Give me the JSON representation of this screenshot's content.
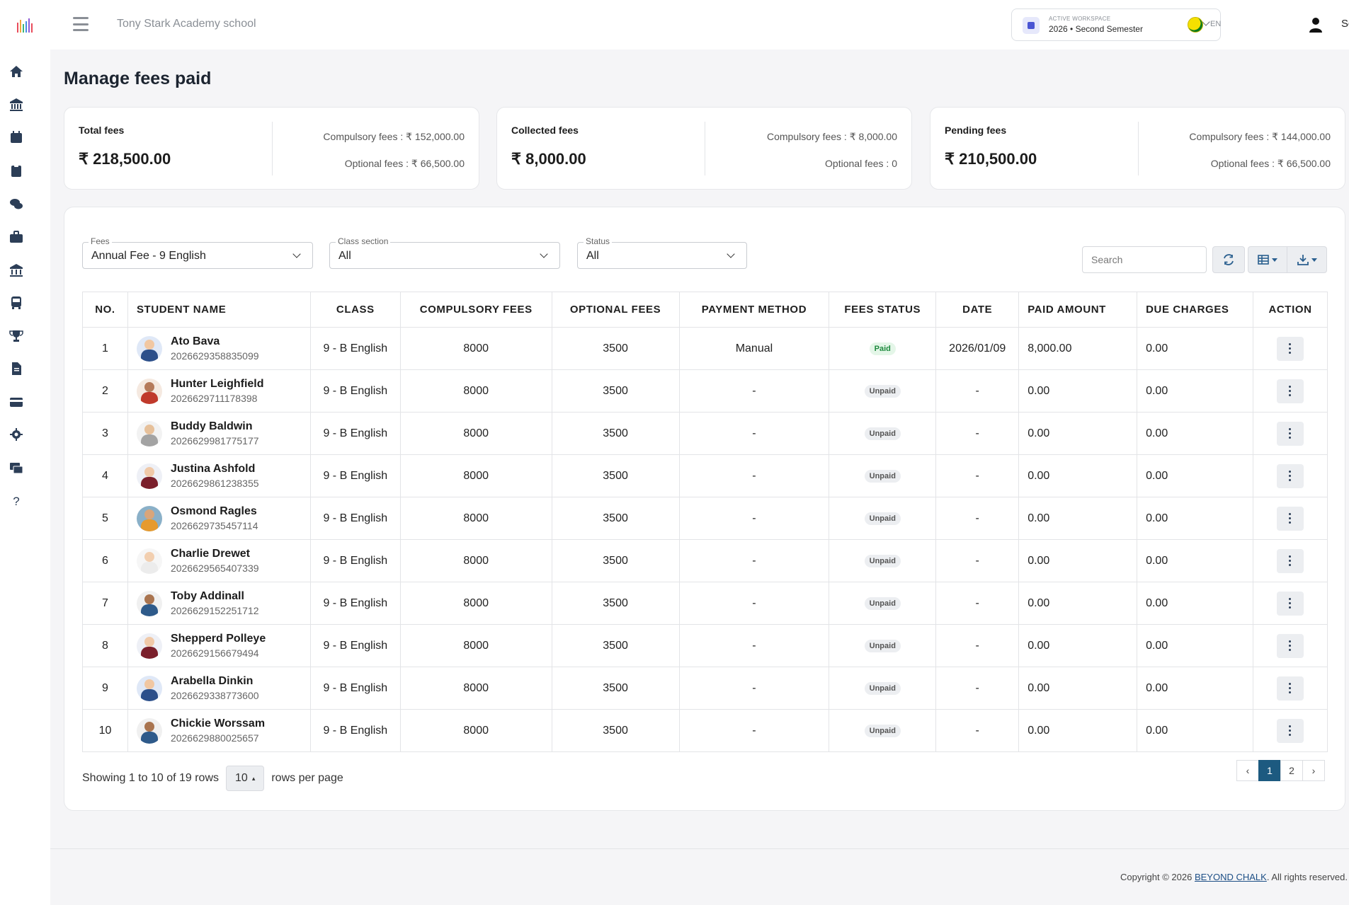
{
  "header": {
    "school_name": "Tony Stark Academy school",
    "workspace_label": "ACTIVE WORKSPACE",
    "workspace_value": "2026 • Second Semester",
    "language": "EN",
    "user": "School"
  },
  "sidebar": {
    "icons": [
      "home-icon",
      "bank-icon",
      "calendar-icon",
      "clipboard-icon",
      "chat-icon",
      "briefcase-icon",
      "institution-icon",
      "bus-icon",
      "trophy-icon",
      "document-icon",
      "card-icon",
      "gear-icon",
      "payment-icon",
      "help-icon"
    ]
  },
  "page": {
    "title": "Manage fees paid"
  },
  "cards": [
    {
      "title": "Total fees",
      "total": "₹ 218,500.00",
      "compulsory": "Compulsory fees : ₹ 152,000.00",
      "optional": "Optional fees : ₹ 66,500.00"
    },
    {
      "title": "Collected fees",
      "total": "₹ 8,000.00",
      "compulsory": "Compulsory fees : ₹ 8,000.00",
      "optional": "Optional fees : 0"
    },
    {
      "title": "Pending fees",
      "total": "₹ 210,500.00",
      "compulsory": "Compulsory fees : ₹ 144,000.00",
      "optional": "Optional fees : ₹ 66,500.00"
    }
  ],
  "filters": {
    "fees_label": "Fees",
    "fees_value": "Annual Fee - 9 English",
    "class_label": "Class section",
    "class_value": "All",
    "status_label": "Status",
    "status_value": "All",
    "search_placeholder": "Search"
  },
  "table": {
    "columns": [
      "NO.",
      "STUDENT NAME",
      "CLASS",
      "COMPULSORY FEES",
      "OPTIONAL FEES",
      "PAYMENT METHOD",
      "FEES STATUS",
      "DATE",
      "PAID AMOUNT",
      "DUE CHARGES",
      "ACTION"
    ],
    "rows": [
      {
        "no": "1",
        "name": "Ato Bava",
        "id": "2026629358835099",
        "class": "9 - B English",
        "compulsory": "8000",
        "optional": "3500",
        "method": "Manual",
        "status": "Paid",
        "date": "2026/01/09",
        "paid": "8,000.00",
        "due": "0.00"
      },
      {
        "no": "2",
        "name": "Hunter Leighfield",
        "id": "2026629711178398",
        "class": "9 - B English",
        "compulsory": "8000",
        "optional": "3500",
        "method": "-",
        "status": "Unpaid",
        "date": "-",
        "paid": "0.00",
        "due": "0.00"
      },
      {
        "no": "3",
        "name": "Buddy Baldwin",
        "id": "2026629981775177",
        "class": "9 - B English",
        "compulsory": "8000",
        "optional": "3500",
        "method": "-",
        "status": "Unpaid",
        "date": "-",
        "paid": "0.00",
        "due": "0.00"
      },
      {
        "no": "4",
        "name": "Justina Ashfold",
        "id": "2026629861238355",
        "class": "9 - B English",
        "compulsory": "8000",
        "optional": "3500",
        "method": "-",
        "status": "Unpaid",
        "date": "-",
        "paid": "0.00",
        "due": "0.00"
      },
      {
        "no": "5",
        "name": "Osmond Ragles",
        "id": "2026629735457114",
        "class": "9 - B English",
        "compulsory": "8000",
        "optional": "3500",
        "method": "-",
        "status": "Unpaid",
        "date": "-",
        "paid": "0.00",
        "due": "0.00"
      },
      {
        "no": "6",
        "name": "Charlie Drewet",
        "id": "2026629565407339",
        "class": "9 - B English",
        "compulsory": "8000",
        "optional": "3500",
        "method": "-",
        "status": "Unpaid",
        "date": "-",
        "paid": "0.00",
        "due": "0.00"
      },
      {
        "no": "7",
        "name": "Toby Addinall",
        "id": "2026629152251712",
        "class": "9 - B English",
        "compulsory": "8000",
        "optional": "3500",
        "method": "-",
        "status": "Unpaid",
        "date": "-",
        "paid": "0.00",
        "due": "0.00"
      },
      {
        "no": "8",
        "name": "Shepperd Polleye",
        "id": "2026629156679494",
        "class": "9 - B English",
        "compulsory": "8000",
        "optional": "3500",
        "method": "-",
        "status": "Unpaid",
        "date": "-",
        "paid": "0.00",
        "due": "0.00"
      },
      {
        "no": "9",
        "name": "Arabella Dinkin",
        "id": "2026629338773600",
        "class": "9 - B English",
        "compulsory": "8000",
        "optional": "3500",
        "method": "-",
        "status": "Unpaid",
        "date": "-",
        "paid": "0.00",
        "due": "0.00"
      },
      {
        "no": "10",
        "name": "Chickie Worssam",
        "id": "2026629880025657",
        "class": "9 - B English",
        "compulsory": "8000",
        "optional": "3500",
        "method": "-",
        "status": "Unpaid",
        "date": "-",
        "paid": "0.00",
        "due": "0.00"
      }
    ]
  },
  "pagination": {
    "showing": "Showing 1 to 10 of 19 rows",
    "page_size": "10",
    "per_page_label": "rows per page",
    "prev": "‹",
    "pages": [
      "1",
      "2"
    ],
    "next": "›",
    "current": "1"
  },
  "footer": {
    "prefix": "Copyright © 2026 ",
    "brand": "BEYOND CHALK",
    "suffix": ". All rights reserved."
  },
  "colors": {
    "accent": "#1d5a80",
    "paid_badge": "#1e8a3e",
    "workspace_icon": "#4a55d3"
  }
}
